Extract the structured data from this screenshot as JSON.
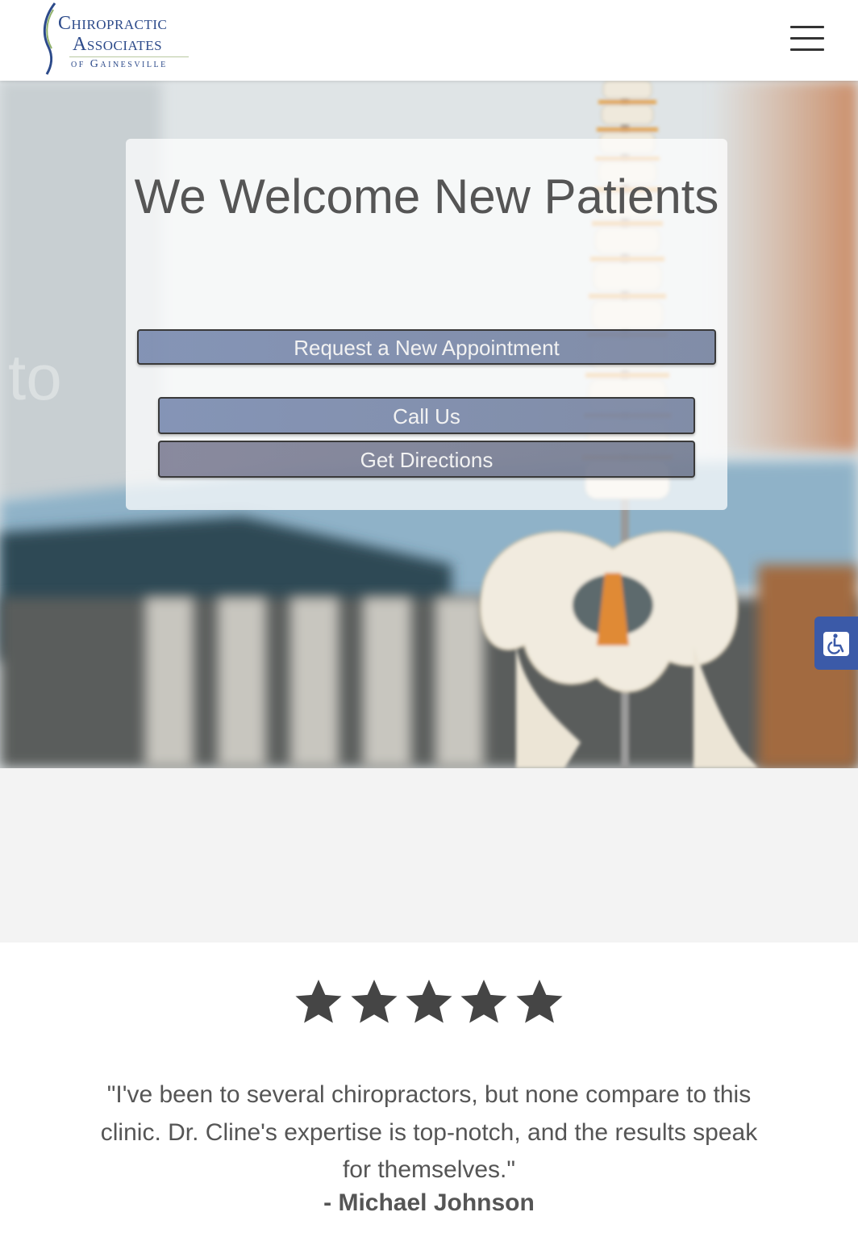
{
  "header": {
    "logo": {
      "line1": "Chiropractic",
      "line2": "Associates",
      "line3": "of Gainesville"
    },
    "menu_icon": "hamburger-menu-icon"
  },
  "hero": {
    "title": "We Welcome New Patients",
    "buttons": {
      "request_appointment": "Request a New Appointment",
      "call_us": "Call Us",
      "get_directions": "Get Directions"
    }
  },
  "accessibility_button": {
    "icon": "wheelchair-icon"
  },
  "testimonial": {
    "rating": 5,
    "quote": "\"I've been to several chiropractors, but none compare to this clinic. Dr. Cline's expertise is top-notch, and the results speak for themselves.\"",
    "author": "- Michael Johnson"
  },
  "colors": {
    "brand_blue": "#2c4a8a",
    "button_fill": "#5f73a0",
    "text_gray": "#555555",
    "a11y_blue": "#3b5aa8"
  }
}
